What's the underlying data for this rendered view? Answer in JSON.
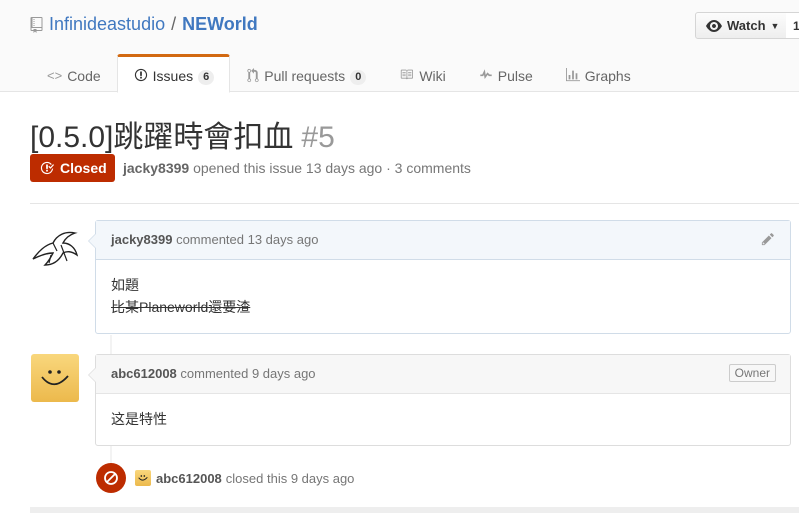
{
  "repo": {
    "owner": "Infinideastudio",
    "separator": "/",
    "name": "NEWorld"
  },
  "watch": {
    "label": "Watch",
    "count": "1"
  },
  "tabs": [
    {
      "label": "Code"
    },
    {
      "label": "Issues",
      "count": "6"
    },
    {
      "label": "Pull requests",
      "count": "0"
    },
    {
      "label": "Wiki"
    },
    {
      "label": "Pulse"
    },
    {
      "label": "Graphs"
    }
  ],
  "issue": {
    "title": "[0.5.0]跳躍時會扣血",
    "number": "#5",
    "state": "Closed",
    "author": "jacky8399",
    "meta_text": "opened this issue 13 days ago · 3 comments"
  },
  "comments": [
    {
      "author": "jacky8399",
      "action": "commented 13 days ago",
      "body_line1": "如題",
      "body_line2_strike": "比某Planeworld還要渣"
    },
    {
      "author": "abc612008",
      "action": "commented 9 days ago",
      "label": "Owner",
      "body": "这是特性"
    }
  ],
  "event": {
    "author": "abc612008",
    "text": "closed this 9 days ago"
  },
  "colors": {
    "link": "#4078c0",
    "closed": "#bd2c00",
    "selected_tab_accent": "#d26911"
  }
}
